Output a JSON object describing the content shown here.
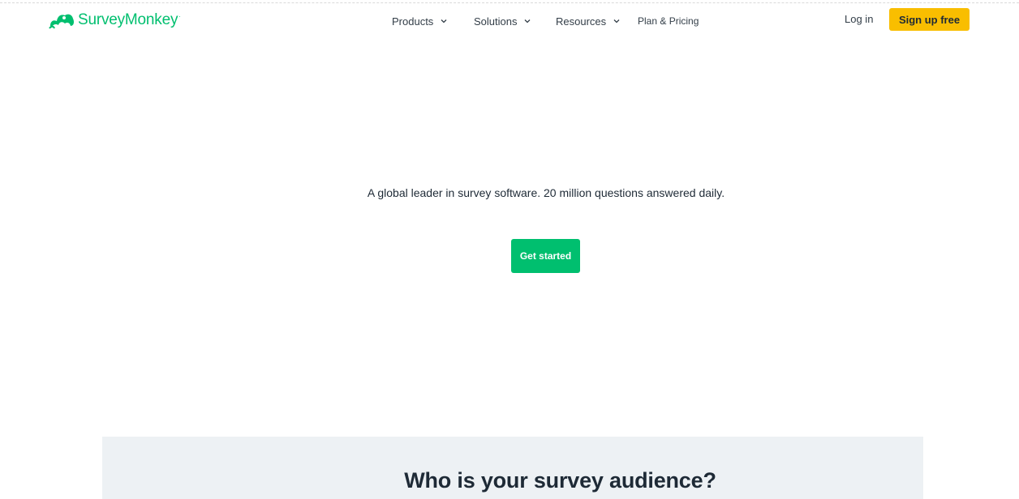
{
  "brand": {
    "name": "SurveyMonkey",
    "trademark": "·",
    "color": "#00bf6f",
    "logo_icon": "monkey-logo-icon"
  },
  "nav": {
    "items": [
      {
        "label": "Products",
        "icon": "chevron-down-icon"
      },
      {
        "label": "Solutions",
        "icon": "chevron-down-icon"
      },
      {
        "label": "Resources",
        "icon": "chevron-down-icon"
      },
      {
        "label": "Plan & Pricing"
      }
    ],
    "login_label": "Log in",
    "signup_label": "Sign up free",
    "signup_color": "#f9be00"
  },
  "hero": {
    "tagline": "A global leader in survey software. 20 million questions answered daily.",
    "cta_label": "Get started",
    "cta_color": "#00bf6f"
  },
  "audience": {
    "title": "Who is your survey audience?",
    "panel_color": "#edf1f4"
  }
}
